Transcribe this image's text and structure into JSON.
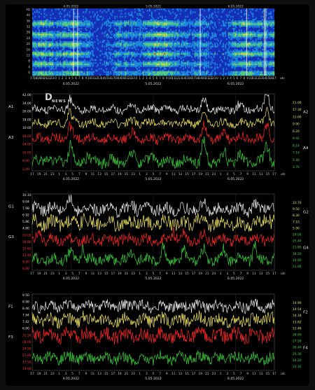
{
  "spectrogram": {
    "y_ticks": [
      "Hz",
      "40",
      "36",
      "32",
      "28",
      "24",
      "20",
      "16",
      "12",
      "8",
      "4",
      "0"
    ],
    "top_labels": [
      "4.05.2022",
      "5.05.2022",
      "6.05.2022"
    ],
    "x_ticks": [
      "17",
      "18",
      "19",
      "20",
      "21",
      "22",
      "23",
      "0",
      "1",
      "2",
      "3",
      "4",
      "5",
      "6",
      "7",
      "8",
      "9",
      "10",
      "11",
      "12",
      "13",
      "14",
      "15",
      "16",
      "17",
      "18",
      "19",
      "20",
      "21",
      "22",
      "23",
      "0",
      "1",
      "2",
      "3",
      "4",
      "5",
      "6",
      "7",
      "8",
      "9",
      "10",
      "11",
      "12",
      "13",
      "14",
      "15",
      "16",
      "17",
      "18",
      "19",
      "20",
      "21",
      "22",
      "23",
      "0",
      "1",
      "2",
      "3",
      "4",
      "5",
      "6",
      "7",
      "8",
      "9",
      "10",
      "11",
      "12",
      "13",
      "14",
      "15",
      "16",
      "17"
    ],
    "bottom_dates": [
      "4.05.2022",
      "5.05.2022",
      "6.05.2022"
    ],
    "unit": "utc"
  },
  "logo": {
    "mark": "D",
    "word": "NEWS"
  },
  "panels": [
    {
      "id": "A",
      "left_labels": [
        "A1",
        "A3"
      ],
      "right_labels": [
        "A2",
        "A4"
      ],
      "left_ticks": [
        {
          "text": "42.00",
          "color": "#e8e8e8"
        },
        {
          "text": "34.00",
          "color": "#e8e8e8"
        },
        {
          "text": "26.00",
          "color": "#e8e8e8"
        },
        {
          "text": "18.00",
          "color": "#e8e8e8"
        },
        {
          "text": "10.00",
          "color": "#e8e8e8"
        },
        {
          "text": "18.00",
          "color": "#ff3b3b"
        },
        {
          "text": "14.00",
          "color": "#ff3b3b"
        },
        {
          "text": "10.00",
          "color": "#ff3b3b"
        },
        {
          "text": "6.00",
          "color": "#ff3b3b"
        },
        {
          "text": "2.00",
          "color": "#ff3b3b"
        }
      ],
      "right_ticks": [
        {
          "text": "21.00",
          "color": "#e8e07a"
        },
        {
          "text": "17.30",
          "color": "#e8e07a"
        },
        {
          "text": "13.60",
          "color": "#e8e07a"
        },
        {
          "text": "9.90",
          "color": "#e8e07a"
        },
        {
          "text": "6.20",
          "color": "#e8e07a"
        },
        {
          "text": "9.92",
          "color": "#4fd14f"
        },
        {
          "text": "8.14",
          "color": "#4fd14f"
        },
        {
          "text": "7.14",
          "color": "#4fd14f"
        },
        {
          "text": "5.40",
          "color": "#4fd14f"
        },
        {
          "text": "3.70",
          "color": "#4fd14f"
        }
      ],
      "x_ticks": [
        "17",
        "19",
        "21",
        "23",
        "1",
        "3",
        "5",
        "7",
        "9",
        "11",
        "13",
        "15",
        "17",
        "19",
        "21",
        "23",
        "1",
        "3",
        "5",
        "7",
        "9",
        "11",
        "13",
        "15",
        "17",
        "19",
        "21",
        "23",
        "1",
        "3",
        "5",
        "7",
        "9",
        "11",
        "13",
        "15",
        "17"
      ],
      "bottom_dates": [
        "4.05.2022",
        "5.05.2022",
        "6.05.2022"
      ],
      "unit": "utc"
    },
    {
      "id": "G",
      "left_labels": [
        "G1",
        "G3"
      ],
      "right_labels": [
        "G2",
        "G4"
      ],
      "left_ticks": [
        {
          "text": "10.10",
          "color": "#e8e8e8"
        },
        {
          "text": "9.04",
          "color": "#e8e8e8"
        },
        {
          "text": "7.98",
          "color": "#e8e8e8"
        },
        {
          "text": "6.92",
          "color": "#e8e8e8"
        },
        {
          "text": "5.86",
          "color": "#e8e8e8"
        },
        {
          "text": "4.80",
          "color": "#e8e8e8"
        },
        {
          "text": "22.00",
          "color": "#ff3b3b"
        },
        {
          "text": "18.80",
          "color": "#ff3b3b"
        },
        {
          "text": "15.60",
          "color": "#ff3b3b"
        },
        {
          "text": "12.40",
          "color": "#ff3b3b"
        },
        {
          "text": "9.20",
          "color": "#ff3b3b"
        },
        {
          "text": "6.00",
          "color": "#ff3b3b"
        }
      ],
      "right_ticks": [
        {
          "text": "10.70",
          "color": "#e8e07a"
        },
        {
          "text": "9.50",
          "color": "#e8e07a"
        },
        {
          "text": "8.30",
          "color": "#e8e07a"
        },
        {
          "text": "7.10",
          "color": "#e8e07a"
        },
        {
          "text": "5.90",
          "color": "#e8e07a"
        },
        {
          "text": "29.00",
          "color": "#4fd14f"
        },
        {
          "text": "25.40",
          "color": "#4fd14f"
        },
        {
          "text": "21.80",
          "color": "#4fd14f"
        },
        {
          "text": "18.20",
          "color": "#4fd14f"
        },
        {
          "text": "14.60",
          "color": "#4fd14f"
        },
        {
          "text": "11.00",
          "color": "#4fd14f"
        }
      ],
      "x_ticks": [
        "17",
        "19",
        "21",
        "23",
        "1",
        "3",
        "5",
        "7",
        "9",
        "11",
        "13",
        "15",
        "17",
        "19",
        "21",
        "23",
        "1",
        "3",
        "5",
        "7",
        "9",
        "11",
        "13",
        "15",
        "17",
        "19",
        "21",
        "23",
        "1",
        "3",
        "5",
        "7",
        "9",
        "11",
        "13",
        "15",
        "17"
      ],
      "bottom_dates": [
        "4.05.2022",
        "5.05.2022",
        "6.05.2022"
      ],
      "unit": "utc"
    },
    {
      "id": "F",
      "left_labels": [
        "F1",
        "F3"
      ],
      "right_labels": [
        "F2",
        "F4"
      ],
      "left_ticks": [
        {
          "text": "9.50",
          "color": "#e8e8e8"
        },
        {
          "text": "8.98",
          "color": "#e8e8e8"
        },
        {
          "text": "8.46",
          "color": "#e8e8e8"
        },
        {
          "text": "7.94",
          "color": "#e8e8e8"
        },
        {
          "text": "7.42",
          "color": "#e8e8e8"
        },
        {
          "text": "6.90",
          "color": "#e8e8e8"
        },
        {
          "text": "31.50",
          "color": "#ff3b3b"
        },
        {
          "text": "28.00",
          "color": "#ff3b3b"
        },
        {
          "text": "24.50",
          "color": "#ff3b3b"
        },
        {
          "text": "21.00",
          "color": "#ff3b3b"
        },
        {
          "text": "17.50",
          "color": "#ff3b3b"
        },
        {
          "text": "14.00",
          "color": "#ff3b3b"
        }
      ],
      "right_ticks": [
        {
          "text": "14.90",
          "color": "#e8e07a"
        },
        {
          "text": "14.54",
          "color": "#e8e07a"
        },
        {
          "text": "14.18",
          "color": "#e8e07a"
        },
        {
          "text": "13.82",
          "color": "#e8e07a"
        },
        {
          "text": "13.46",
          "color": "#e8e07a"
        },
        {
          "text": "28.60",
          "color": "#4fd14f"
        },
        {
          "text": "27.50",
          "color": "#4fd14f"
        },
        {
          "text": "26.40",
          "color": "#4fd14f"
        },
        {
          "text": "25.30",
          "color": "#4fd14f"
        },
        {
          "text": "24.20",
          "color": "#4fd14f"
        },
        {
          "text": "23.10",
          "color": "#4fd14f"
        }
      ],
      "x_ticks": [
        "17",
        "19",
        "21",
        "23",
        "1",
        "3",
        "5",
        "7",
        "9",
        "11",
        "13",
        "15",
        "17",
        "19",
        "21",
        "23",
        "1",
        "3",
        "5",
        "7",
        "9",
        "11",
        "13",
        "15",
        "17",
        "19",
        "21",
        "23",
        "1",
        "3",
        "5",
        "7",
        "9",
        "11",
        "13",
        "15",
        "17"
      ],
      "bottom_dates": [
        "4.05.2022",
        "5.05.2022",
        "6.05.2022"
      ],
      "unit": "utc"
    }
  ],
  "chart_data": [
    {
      "type": "heatmap",
      "x": "time (utc), 4.05.2022 17:00 to 6.05.2022 17:00",
      "yticks": [
        "40",
        "36",
        "32",
        "28",
        "24",
        "20",
        "16",
        "12",
        "8",
        "4",
        "0"
      ],
      "ylabel": "Hz",
      "ylim": [
        0,
        40
      ],
      "bands_hz": [
        7.8,
        14,
        20,
        26,
        33
      ],
      "spike_times_h": [
        8.2,
        9.0,
        33.3,
        42.5,
        46.0,
        46.3
      ],
      "colors": [
        "#1436c8",
        "#1fa0e8",
        "#5fe07a",
        "#e8e040",
        "#e03030"
      ]
    },
    {
      "type": "line",
      "x_range_h": [
        0,
        48
      ],
      "series": [
        {
          "name": "A1",
          "color": "#f0f0f0",
          "base": 0.8,
          "amp": 0.05,
          "peaks": [
            [
              7.5,
              0.55
            ],
            [
              20,
              0.12
            ],
            [
              24,
              0.08
            ],
            [
              34,
              0.45
            ],
            [
              41,
              0.2
            ],
            [
              46.5,
              0.9
            ]
          ]
        },
        {
          "name": "A2",
          "color": "#f4e96a",
          "base": 0.62,
          "amp": 0.05,
          "peaks": [
            [
              7.5,
              0.55
            ],
            [
              20,
              0.15
            ],
            [
              34,
              0.4
            ],
            [
              46.5,
              0.7
            ]
          ]
        },
        {
          "name": "A3",
          "color": "#ff2a2a",
          "base": 0.42,
          "amp": 0.06,
          "peaks": [
            [
              7.5,
              0.6
            ],
            [
              20,
              0.35
            ],
            [
              34,
              0.5
            ],
            [
              38,
              0.2
            ],
            [
              46.5,
              0.75
            ]
          ]
        },
        {
          "name": "A4",
          "color": "#3fd13f",
          "base": 0.12,
          "amp": 0.07,
          "peaks": [
            [
              3,
              0.25
            ],
            [
              7.5,
              0.7
            ],
            [
              11,
              0.3
            ],
            [
              20,
              0.4
            ],
            [
              24,
              0.25
            ],
            [
              34,
              0.9
            ],
            [
              38,
              0.35
            ],
            [
              41,
              0.3
            ],
            [
              46.5,
              0.85
            ]
          ]
        }
      ]
    },
    {
      "type": "line",
      "x_range_h": [
        0,
        48
      ],
      "series": [
        {
          "name": "G1",
          "color": "#f0f0f0",
          "base": 0.8,
          "amp": 0.08,
          "peaks": [
            [
              7.5,
              0.35
            ],
            [
              10,
              0.25
            ],
            [
              20,
              0.3
            ],
            [
              23,
              0.25
            ],
            [
              34,
              0.2
            ],
            [
              44,
              0.2
            ],
            [
              46.5,
              0.25
            ]
          ]
        },
        {
          "name": "G2",
          "color": "#f4e96a",
          "base": 0.62,
          "amp": 0.09,
          "peaks": [
            [
              10,
              0.25
            ],
            [
              20,
              0.15
            ],
            [
              33,
              0.2
            ],
            [
              46.5,
              0.35
            ]
          ]
        },
        {
          "name": "G3",
          "color": "#ff2a2a",
          "base": 0.4,
          "amp": 0.07,
          "peaks": [
            [
              1.5,
              0.25
            ],
            [
              28,
              0.35
            ],
            [
              30,
              0.3
            ],
            [
              34,
              0.2
            ]
          ]
        },
        {
          "name": "G4",
          "color": "#3fd13f",
          "base": 0.14,
          "amp": 0.07,
          "peaks": [
            [
              7.5,
              0.4
            ],
            [
              10,
              0.45
            ],
            [
              20,
              0.35
            ],
            [
              26,
              0.45
            ],
            [
              30,
              0.3
            ],
            [
              34,
              0.4
            ],
            [
              38,
              0.45
            ],
            [
              44,
              0.5
            ]
          ]
        }
      ]
    },
    {
      "type": "line",
      "x_range_h": [
        0,
        48
      ],
      "series": [
        {
          "name": "F1",
          "color": "#f0f0f0",
          "base": 0.84,
          "amp": 0.07,
          "peaks": [
            [
              20,
              0.15
            ],
            [
              33,
              0.12
            ]
          ]
        },
        {
          "name": "F2",
          "color": "#f4e96a",
          "base": 0.66,
          "amp": 0.08,
          "peaks": [
            [
              10,
              0.1
            ],
            [
              33,
              0.1
            ],
            [
              46.5,
              0.12
            ]
          ]
        },
        {
          "name": "F3",
          "color": "#ff2a2a",
          "base": 0.46,
          "amp": 0.09,
          "peaks": [
            [
              2,
              0.1
            ],
            [
              20,
              0.12
            ],
            [
              34,
              0.1
            ]
          ]
        },
        {
          "name": "F4",
          "color": "#3fd13f",
          "base": 0.16,
          "amp": 0.07,
          "peaks": [
            [
              20,
              -0.1
            ],
            [
              26,
              0.12
            ],
            [
              34,
              0.08
            ]
          ]
        }
      ]
    }
  ]
}
